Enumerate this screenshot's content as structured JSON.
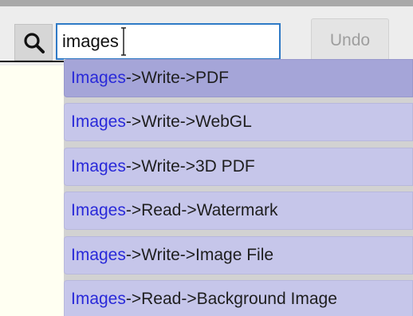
{
  "search": {
    "value": "images",
    "icon": "magnifier-icon"
  },
  "toolbar": {
    "undo_label": "Undo"
  },
  "suggestions": [
    {
      "match": "Images",
      "rest": "->Write->PDF",
      "selected": true
    },
    {
      "match": "Images",
      "rest": "->Write->WebGL",
      "selected": false
    },
    {
      "match": "Images",
      "rest": "->Write->3D PDF",
      "selected": false
    },
    {
      "match": "Images",
      "rest": "->Read->Watermark",
      "selected": false
    },
    {
      "match": "Images",
      "rest": "->Write->Image File",
      "selected": false
    },
    {
      "match": "Images",
      "rest": "->Read->Background Image",
      "selected": false
    }
  ],
  "colors": {
    "match_text": "#2929d9",
    "suggestion_bg": "#c6c6ea",
    "suggestion_selected_bg": "#a5a5d8",
    "input_border": "#2f7ac6"
  }
}
